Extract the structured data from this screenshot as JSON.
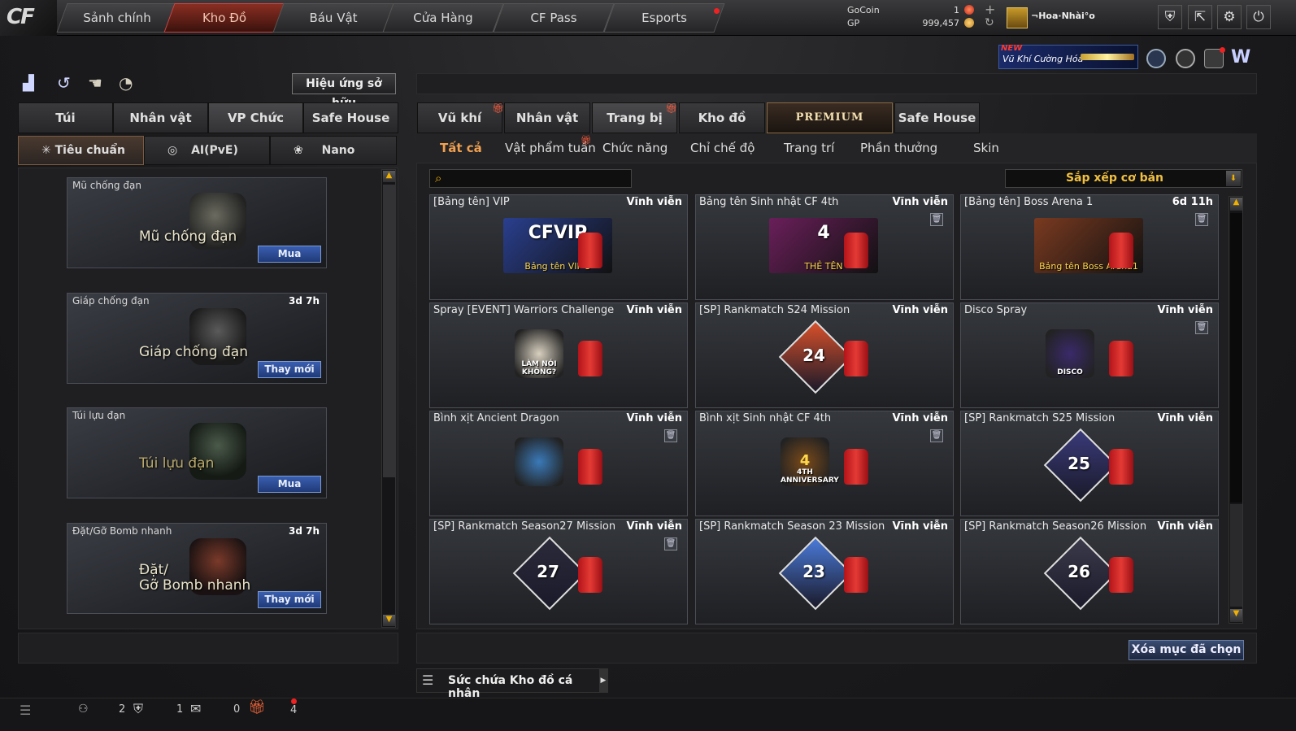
{
  "top_nav": {
    "logo": "CF",
    "tabs": [
      "Sảnh chính",
      "Kho Đồ",
      "Báu Vật",
      "Cửa Hàng",
      "CF Pass",
      "Esports"
    ],
    "active_tab": "Kho Đồ"
  },
  "currency": {
    "gocoin_label": "GoCoin",
    "gocoin_value": "1",
    "gp_label": "GP",
    "gp_value": "999,457"
  },
  "user": {
    "name": "¬Hoa·Nhài°o"
  },
  "promo_banner": {
    "new_label": "NEW",
    "text": "Vũ Khí Cường Hóa"
  },
  "left": {
    "owned_effects_button": "Hiệu ứng sở hữu",
    "tabs": [
      "Túi",
      "Nhân vật",
      "VP Chức năng",
      "Safe House"
    ],
    "selected_tab": "VP Chức năng",
    "subtabs": [
      "Tiêu chuẩn",
      "AI(PvE)",
      "Nano"
    ],
    "slots": [
      {
        "name": "Mũ chống đạn",
        "time": "",
        "big_label": "Mũ chống đạn",
        "action": "Mua"
      },
      {
        "name": "Giáp chống đạn",
        "time": "3d 7h",
        "big_label": "Giáp chống đạn",
        "action": "Thay mới"
      },
      {
        "name": "Túi lựu đạn",
        "time": "",
        "big_label": "Túi lựu đạn",
        "action": "Mua"
      },
      {
        "name": "Đặt/Gỡ Bomb nhanh",
        "time": "3d 7h",
        "big_label": "Đặt/\nGỡ Bomb nhanh",
        "action": "Thay mới"
      }
    ]
  },
  "right": {
    "tabs": [
      "Vũ khí",
      "Nhân vật",
      "Trang bị",
      "Kho đồ",
      "PREMIUM",
      "Safe House"
    ],
    "selected_tab": "Trang bị",
    "subtabs": [
      "Tất cả",
      "Vật phẩm tuần",
      "Chức năng",
      "Chỉ chế độ",
      "Trang trí",
      "Phần thưởng",
      "Skin"
    ],
    "selected_subtab": "Tất cả",
    "search_placeholder": "",
    "sort_label": "Sắp xếp cơ bản",
    "items": [
      {
        "name": "[Bảng tên] VIP",
        "duration": "Vĩnh viễn",
        "art_text": "Bảng tên VIP 5",
        "art_title": "CFVIP",
        "trash": false,
        "kind": "nameplate",
        "color": "#2a3f8f"
      },
      {
        "name": "Bảng tên Sinh nhật CF 4th",
        "duration": "Vĩnh viễn",
        "art_text": "THẺ TÊN",
        "art_title": "4",
        "trash": true,
        "kind": "nameplate",
        "color": "#6a1f5a"
      },
      {
        "name": "[Bảng tên] Boss Arena 1",
        "duration": "6d 11h",
        "art_text": "Bảng tên Boss Arena1",
        "art_title": "",
        "trash": true,
        "kind": "nameplate",
        "color": "#7a3a20"
      },
      {
        "name": "Spray [EVENT] Warriors Challenge",
        "duration": "Vĩnh viễn",
        "art_text": "LÀM NÓI KHÔNG?",
        "art_title": "",
        "trash": false,
        "kind": "spray",
        "color": "#d8d0c0"
      },
      {
        "name": "[SP] Rankmatch S24 Mission",
        "duration": "Vĩnh viễn",
        "art_text": "",
        "art_title": "24",
        "trash": false,
        "kind": "rank",
        "color": "#d8502a"
      },
      {
        "name": "Disco Spray",
        "duration": "Vĩnh viễn",
        "art_text": "DISCO",
        "art_title": "",
        "trash": true,
        "kind": "spray",
        "color": "#3a2a6a"
      },
      {
        "name": "Bình xịt Ancient Dragon",
        "duration": "Vĩnh viễn",
        "art_text": "",
        "art_title": "",
        "trash": true,
        "kind": "spray",
        "color": "#3a7ab8"
      },
      {
        "name": "Bình xịt Sinh nhật CF 4th",
        "duration": "Vĩnh viễn",
        "art_text": "4TH ANNIVERSARY",
        "art_title": "4",
        "trash": true,
        "kind": "spray",
        "color": "#7a4a1a"
      },
      {
        "name": "[SP] Rankmatch S25 Mission",
        "duration": "Vĩnh viễn",
        "art_text": "",
        "art_title": "25",
        "trash": false,
        "kind": "rank",
        "color": "#3a3a7a"
      },
      {
        "name": "[SP] Rankmatch Season27 Mission",
        "duration": "Vĩnh viễn",
        "art_text": "",
        "art_title": "27",
        "trash": true,
        "kind": "rank",
        "color": "#2a2a3a"
      },
      {
        "name": "[SP] Rankmatch Season 23 Mission",
        "duration": "Vĩnh viễn",
        "art_text": "",
        "art_title": "23",
        "trash": false,
        "kind": "rank",
        "color": "#4a7ad8"
      },
      {
        "name": "[SP] Rankmatch Season26 Mission",
        "duration": "Vĩnh viễn",
        "art_text": "",
        "art_title": "26",
        "trash": false,
        "kind": "rank",
        "color": "#3a3a4a"
      }
    ],
    "delete_button": "Xóa mục đã chọn",
    "capacity_label": "Sức chứa Kho đồ cá nhân"
  },
  "status_bar": {
    "count_a": "2",
    "count_b": "1",
    "count_c": "0",
    "count_d": "4"
  }
}
